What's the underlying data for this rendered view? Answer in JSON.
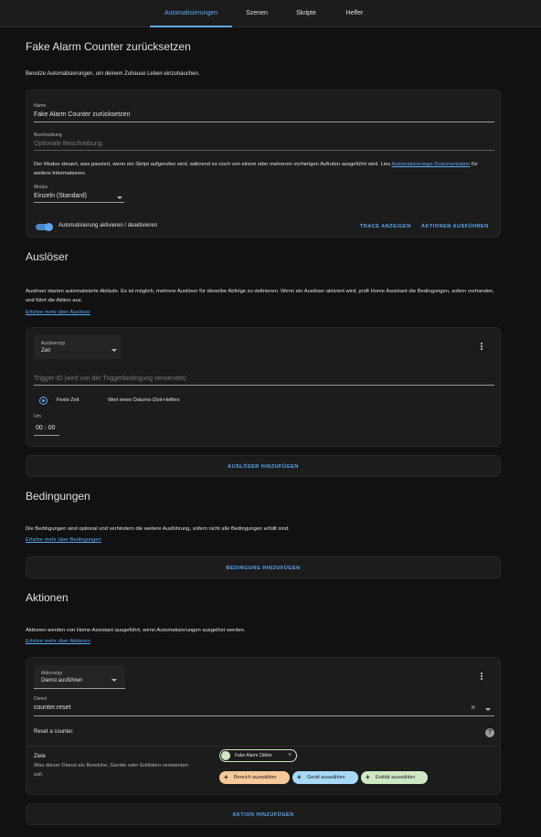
{
  "tabs": [
    {
      "label": "Automatisierungen",
      "active": true
    },
    {
      "label": "Szenen",
      "active": false
    },
    {
      "label": "Skripte",
      "active": false
    },
    {
      "label": "Helfer",
      "active": false
    }
  ],
  "page_title": "Fake Alarm Counter zurücksetzen",
  "intro_text": "Benutze Automatisierungen, um deinem Zuhause Leben einzuhauchen.",
  "details": {
    "name_label": "Name",
    "name_value": "Fake Alarm Counter zurücksetzen",
    "desc_label": "Beschreibung",
    "desc_placeholder": "Optionale Beschreibung",
    "mode_info_1": "Der Modus steuert, was passiert, wenn ein Skript aufgerufen wird, während es noch von einem oder mehreren vorherigen Aufrufen ausgeführt wird. Lies ",
    "mode_link": "Automatisierungs-Dokumentation",
    "mode_info_2": " für weitere Informationen.",
    "mode_label": "Modus",
    "mode_value": "Einzeln (Standard)",
    "toggle_label": "Automatisierung aktivieren / deaktivieren",
    "trace_button": "TRACE ANZEIGEN",
    "run_button": "AKTIONEN AUSFÜHREN"
  },
  "triggers": {
    "title": "Auslöser",
    "info": "Auslöser starten automatisierte Abläufe. Es ist möglich, mehrere Auslöser für dieselbe Abfolge zu definieren. Wenn ein Auslöser aktiviert wird, prüft Home Assistant die Bedingungen, sofern vorhanden, und führt die Aktion aus.",
    "learn_more": "Erfahre mehr über Auslöser",
    "type_label": "Auslösertyp",
    "type_value": "Zeit",
    "trigger_id_placeholder": "Trigger-ID (wird von der Triggerbedingung verwendet)",
    "radio_fixed": "Feste Zeit",
    "radio_helper": "Wert eines Datums-/Zeit-Helfers",
    "at_label": "Um",
    "at_value": "00 : 00",
    "add_button": "AUSLÖSER HINZUFÜGEN"
  },
  "conditions": {
    "title": "Bedingungen",
    "info": "Die Bedingungen sind optional und verhindern die weitere Ausführung, sofern nicht alle Bedingungen erfüllt sind.",
    "learn_more": "Erfahre mehr über Bedingungen",
    "add_button": "BEDINGUNG HINZUFÜGEN"
  },
  "actions": {
    "title": "Aktionen",
    "info": "Aktionen werden von Home Assistant ausgeführt, wenn Automatisierungen ausgelöst werden.",
    "learn_more": "Erfahre mehr über Aktionen",
    "type_label": "Aktionstyp",
    "type_value": "Dienst ausführen",
    "service_label": "Dienst",
    "service_value": "counter.reset",
    "service_desc": "Reset a counter.",
    "targets_title": "Ziele",
    "targets_desc": "Was dieser Dienst als Bereiche, Geräte oder Entitäten verwenden soll.",
    "entity_chip": "Fake Alarm Zähler",
    "area_button": "Bereich auswählen",
    "device_button": "Gerät auswählen",
    "entity_button": "Entität auswählen",
    "add_button": "AKTION HINZUFÜGEN"
  },
  "colors": {
    "accent": "#5aa9f5",
    "area_chip": "#f7c99a",
    "device_chip": "#a8d9f7",
    "entity_chip": "#cfe8c4"
  }
}
